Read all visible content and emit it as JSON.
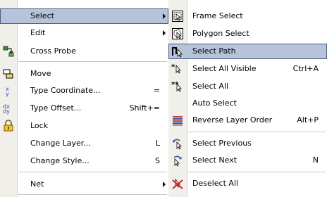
{
  "main_menu": {
    "select": {
      "label": "Select"
    },
    "edit": {
      "label": "Edit"
    },
    "cross_probe": {
      "label": "Cross Probe"
    },
    "move": {
      "label": "Move"
    },
    "type_coordinate": {
      "label": "Type Coordinate...",
      "shortcut": "="
    },
    "type_offset": {
      "label": "Type Offset...",
      "shortcut": "Shift+="
    },
    "lock": {
      "label": "Lock"
    },
    "change_layer": {
      "label": "Change Layer...",
      "shortcut": "L"
    },
    "change_style": {
      "label": "Change Style...",
      "shortcut": "S"
    },
    "net": {
      "label": "Net"
    }
  },
  "sub_menu": {
    "frame_select": {
      "label": "Frame Select"
    },
    "polygon_select": {
      "label": "Polygon Select"
    },
    "select_path": {
      "label": "Select Path"
    },
    "select_all_visible": {
      "label": "Select All Visible",
      "shortcut": "Ctrl+A"
    },
    "select_all": {
      "label": "Select All"
    },
    "auto_select": {
      "label": "Auto Select"
    },
    "reverse_layer_order": {
      "label": "Reverse Layer Order",
      "shortcut": "Alt+P"
    },
    "select_previous": {
      "label": "Select Previous"
    },
    "select_next": {
      "label": "Select Next",
      "shortcut": "N"
    },
    "deselect_all": {
      "label": "Deselect All"
    }
  },
  "colors": {
    "highlight": "#b6c3d9",
    "highlight_border": "#4b5e86",
    "gutter": "#f1efe9"
  }
}
